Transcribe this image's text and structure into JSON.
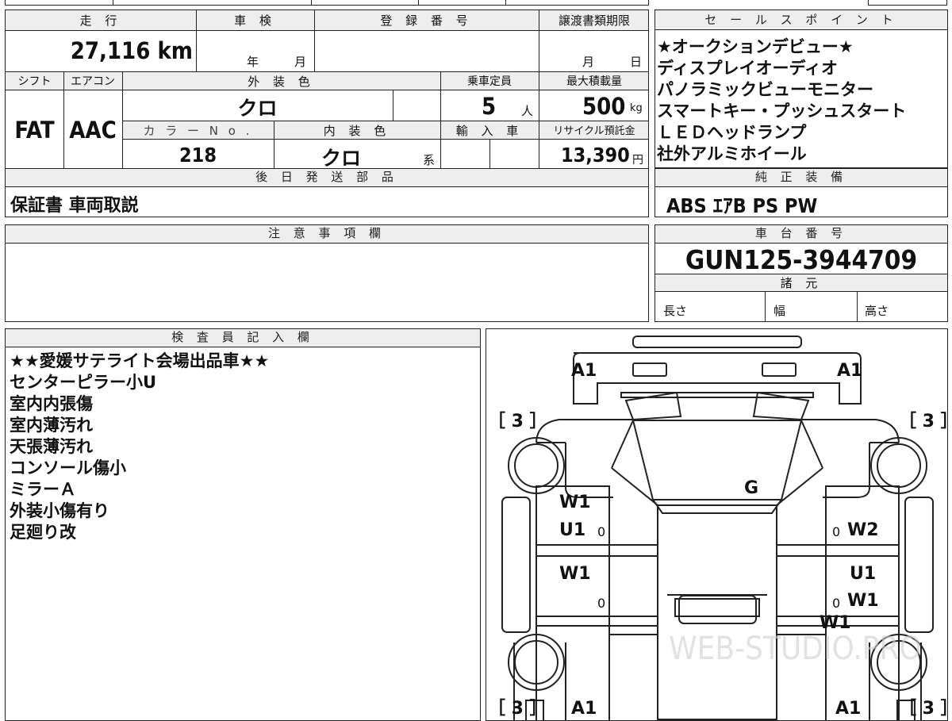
{
  "specs": {
    "mileage": {
      "header": "走 行",
      "value": "27,116",
      "unit": "km"
    },
    "shaken": {
      "header": "車 検",
      "year": "年",
      "month": "月"
    },
    "registration": {
      "header": "登 録 番 号"
    },
    "transfer_deadline": {
      "header": "譲渡書類期限",
      "month": "月",
      "day": "日"
    },
    "shift": {
      "header": "シフト",
      "value": "FAT"
    },
    "aircon": {
      "header": "エアコン",
      "value": "AAC"
    },
    "exterior_color": {
      "header": "外 装 色",
      "value": "クロ"
    },
    "capacity": {
      "header": "乗車定員",
      "value": "5",
      "unit": "人"
    },
    "max_load": {
      "header": "最大積載量",
      "value": "500",
      "unit": "kg"
    },
    "color_no": {
      "header": "カ ラ ー N o .",
      "value": "218"
    },
    "interior_color": {
      "header": "内 装 色",
      "value": "クロ",
      "suffix": "系"
    },
    "import": {
      "header": "輸 入 車"
    },
    "recycle": {
      "header": "リサイクル預託金",
      "value": "13,390",
      "unit": "円"
    }
  },
  "later_parts": {
    "header": "後 日 発 送 部 品",
    "value": "保証書 車両取説"
  },
  "sales_points": {
    "header": "セ ー ル ス ポ イ ン ト",
    "items": [
      "★オークションデビュー★",
      "ディスプレイオーディオ",
      "パノラミックビューモニター",
      "スマートキー・プッシュスタート",
      "ＬＥＤヘッドランプ",
      "社外アルミホイール"
    ]
  },
  "equipment": {
    "header": "純 正 装 備",
    "value": "ABS ｴｱB PS PW"
  },
  "notes": {
    "header": "注 意 事 項 欄",
    "value": ""
  },
  "chassis": {
    "header": "車 台 番 号",
    "value": "GUN125-3944709"
  },
  "dimensions": {
    "header": "諸 元",
    "length": "長さ",
    "width": "幅",
    "height": "高さ"
  },
  "inspector": {
    "header": "検 査 員 記 入 欄",
    "lines": [
      "★★愛媛サテライト会場出品車★★",
      "センターピラー小U",
      "室内内張傷",
      "室内薄汚れ",
      "天張薄汚れ",
      "コンソール傷小",
      "ミラーＡ",
      "外装小傷有り",
      "足廻り改"
    ]
  },
  "diagram": {
    "marks": {
      "a1_front_left": "A1",
      "a1_front_right": "A1",
      "g_roof": "G",
      "w1_left_front_door": "W1",
      "u1_left_front_door": "U1",
      "w2_right_front_door": "W2",
      "w1_left_rear_door": "W1",
      "u1_right_rear_door": "U1",
      "w1_right_rear_door": "W1",
      "w1_right_rocker": "W1",
      "a1_rear_left": "A1",
      "a1_rear_right": "A1"
    },
    "bracket_3": "［ 3 ］",
    "zero": "0",
    "watermark": "WEB-STUDIO.PRO"
  }
}
